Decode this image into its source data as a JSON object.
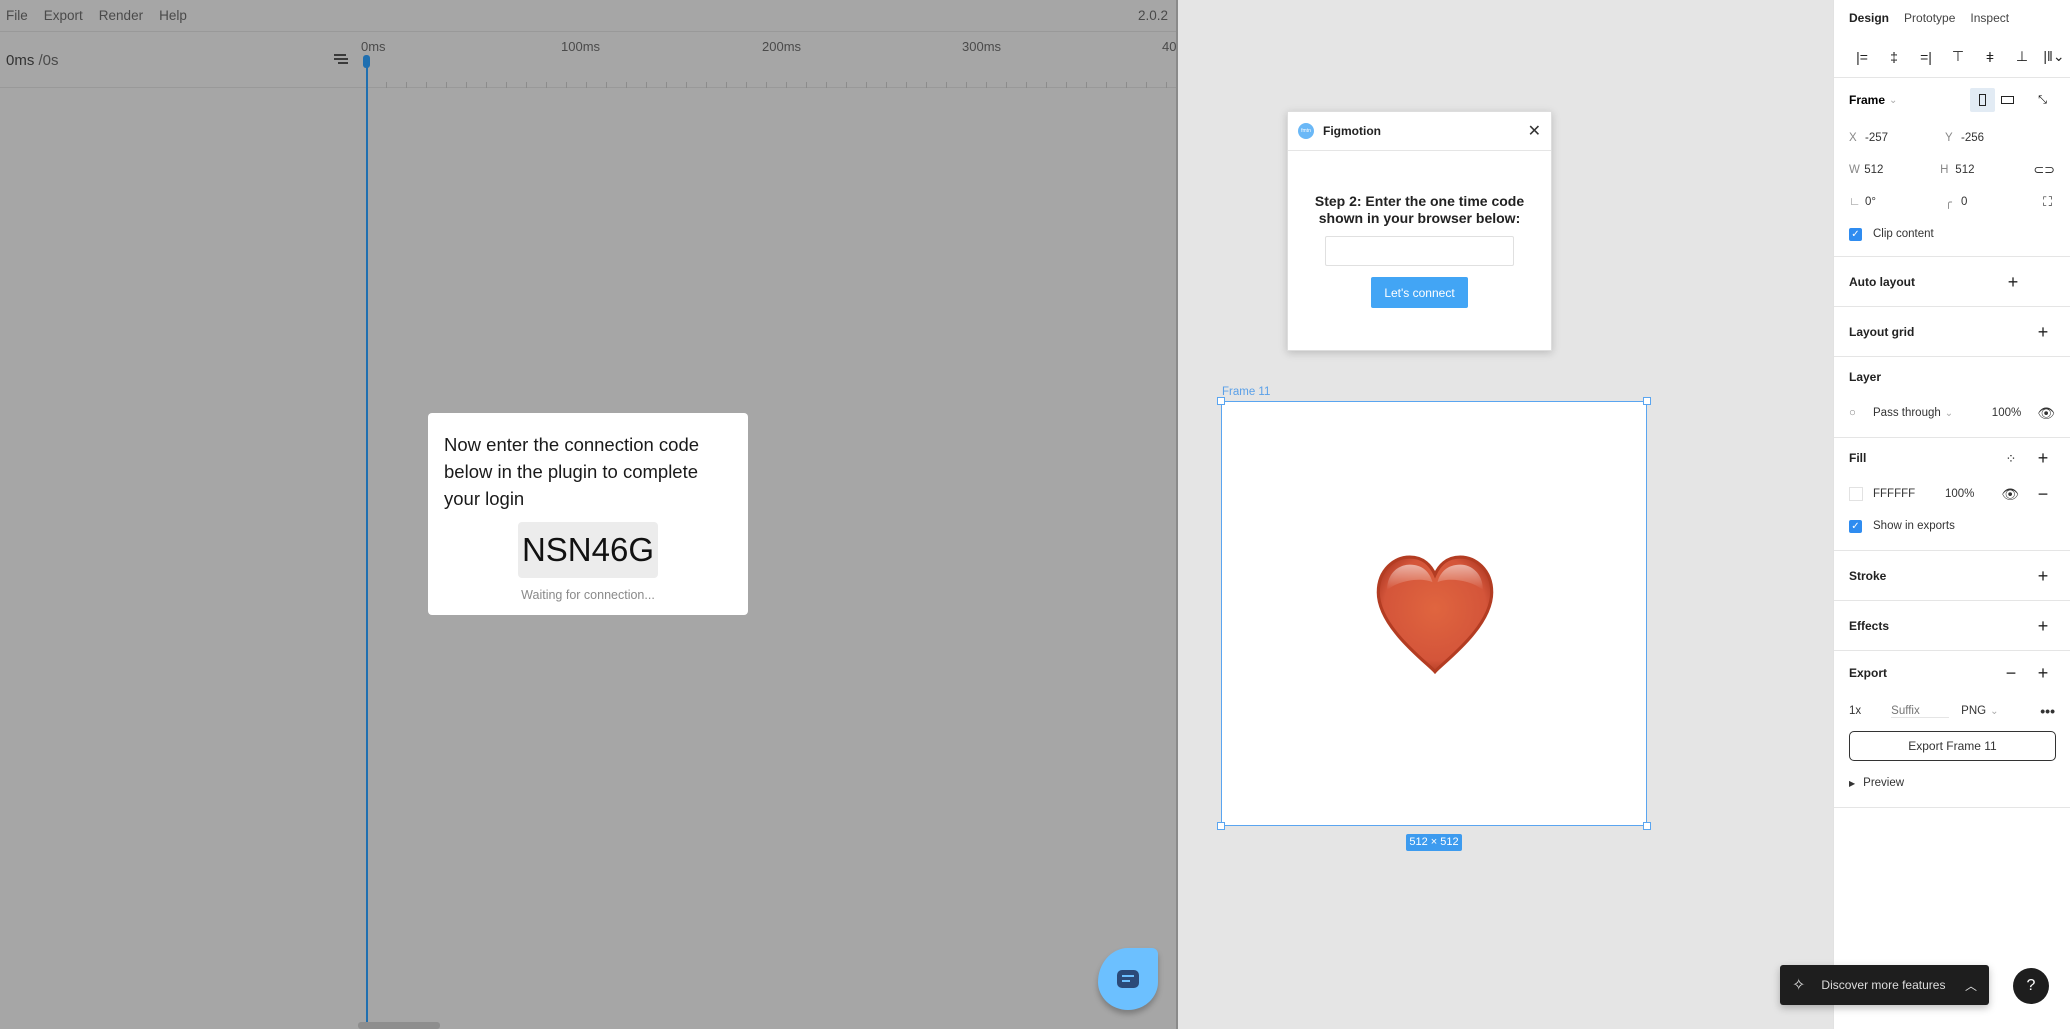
{
  "app": {
    "menu": [
      "File",
      "Export",
      "Render",
      "Help"
    ],
    "version": "2.0.2"
  },
  "timeline": {
    "current_time": "0ms",
    "total_time": "/0s",
    "tick_labels": [
      "0ms",
      "100ms",
      "200ms",
      "300ms",
      "40"
    ]
  },
  "connect_dialog": {
    "message": "Now enter the connection code below in the plugin to complete your login",
    "code": "NSN46G",
    "status": "Waiting for connection..."
  },
  "plugin": {
    "logo_text": "fmtn",
    "title": "Figmotion",
    "step_text": "Step 2: Enter the one time code shown in your browser below:",
    "code_input_value": "",
    "connect_label": "Let's connect"
  },
  "canvas": {
    "frame_name": "Frame 11",
    "frame_size": "512 × 512",
    "content_emoji": "heart"
  },
  "design_panel": {
    "tabs": [
      "Design",
      "Prototype",
      "Inspect"
    ],
    "active_tab": "Design",
    "frame": {
      "label": "Frame",
      "x": "-257",
      "y": "-256",
      "w": "512",
      "h": "512",
      "rotation": "0°",
      "radius": "0",
      "clip_content_label": "Clip content",
      "clip_content": true
    },
    "auto_layout": "Auto layout",
    "layout_grid": "Layout grid",
    "layer": {
      "label": "Layer",
      "blend_mode": "Pass through",
      "opacity": "100%"
    },
    "fill": {
      "label": "Fill",
      "color": "FFFFFF",
      "opacity": "100%",
      "show_in_exports_label": "Show in exports",
      "show_in_exports": true
    },
    "stroke": "Stroke",
    "effects": "Effects",
    "export": {
      "label": "Export",
      "scale": "1x",
      "suffix_placeholder": "Suffix",
      "format": "PNG",
      "button_label": "Export Frame 11",
      "preview_label": "Preview"
    }
  },
  "discover": {
    "label": "Discover more features"
  },
  "help": {
    "label": "?"
  },
  "colors": {
    "accent": "#42a5f5",
    "selection": "#5aa5f0",
    "playhead": "#1f6fb0"
  }
}
